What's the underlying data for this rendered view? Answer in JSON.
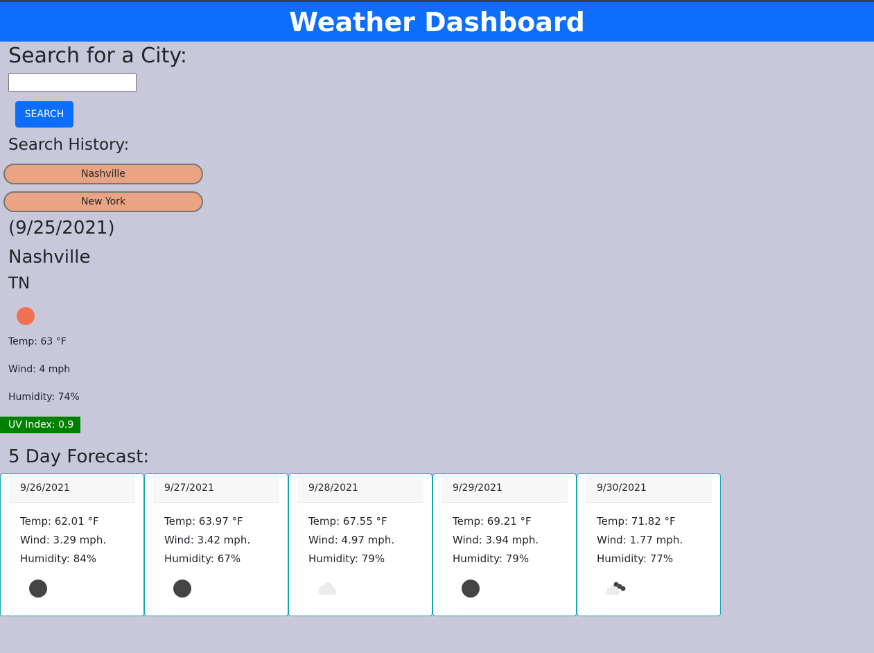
{
  "header": {
    "title": "Weather Dashboard"
  },
  "search": {
    "title": "Search for a City:",
    "input_value": "",
    "placeholder": "",
    "button_label": "SEARCH"
  },
  "history": {
    "title": "Search History:",
    "items": [
      {
        "label": "Nashville"
      },
      {
        "label": "New York"
      }
    ]
  },
  "current": {
    "date": "(9/25/2021)",
    "city": "Nashville",
    "state": "TN",
    "icon": "sun-icon",
    "temp": "Temp: 63 °F",
    "wind": "Wind: 4 mph",
    "humidity": "Humidity: 74%",
    "uv": "UV Index: 0.9",
    "uv_color": "#008000"
  },
  "forecast": {
    "title": "5 Day Forecast:",
    "days": [
      {
        "date": "9/26/2021",
        "temp": "Temp: 62.01 °F",
        "wind": "Wind: 3.29 mph.",
        "humidity": "Humidity: 84%",
        "icon": "dark-circle-icon"
      },
      {
        "date": "9/27/2021",
        "temp": "Temp: 63.97 °F",
        "wind": "Wind: 3.42 mph.",
        "humidity": "Humidity: 67%",
        "icon": "dark-circle-icon"
      },
      {
        "date": "9/28/2021",
        "temp": "Temp: 67.55 °F",
        "wind": "Wind: 4.97 mph.",
        "humidity": "Humidity: 79%",
        "icon": "cloud-icon"
      },
      {
        "date": "9/29/2021",
        "temp": "Temp: 69.21 °F",
        "wind": "Wind: 3.94 mph.",
        "humidity": "Humidity: 79%",
        "icon": "dark-circle-icon"
      },
      {
        "date": "9/30/2021",
        "temp": "Temp: 71.82 °F",
        "wind": "Wind: 1.77 mph.",
        "humidity": "Humidity: 77%",
        "icon": "broken-clouds-icon"
      }
    ]
  },
  "colors": {
    "primary": "#0d6efd",
    "background": "#c8c8da",
    "history_button": "#eba483",
    "sun": "#ef7151",
    "card_border": "#17a2b8"
  }
}
